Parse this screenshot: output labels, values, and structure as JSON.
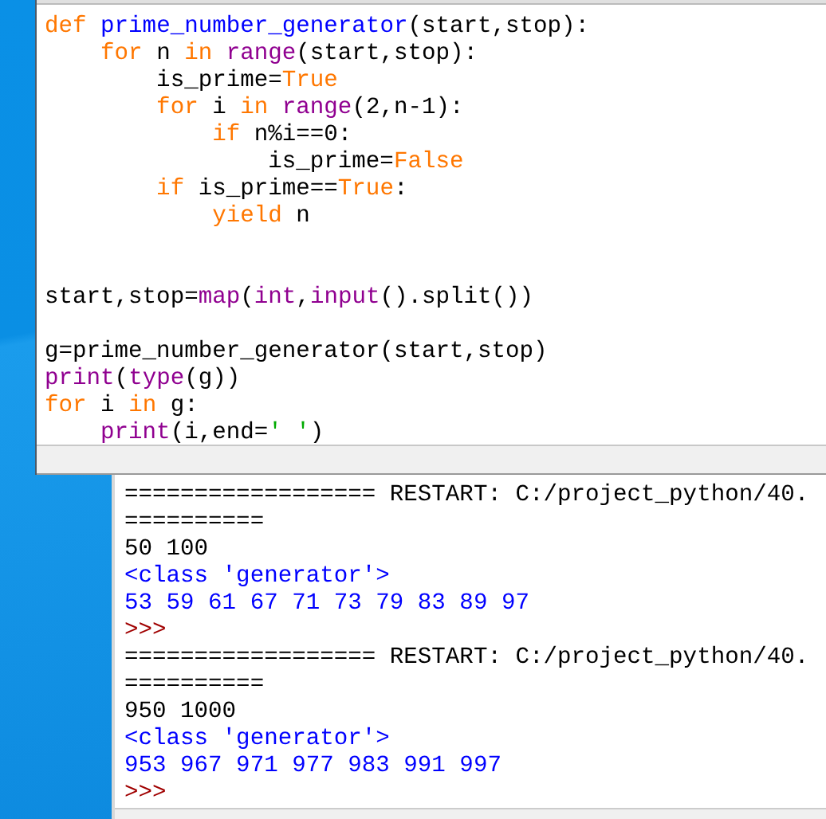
{
  "editor": {
    "lines": [
      {
        "kind": "code",
        "tokens": [
          {
            "text": "def",
            "kind": "keyword"
          },
          {
            "text": " prime_number_generator",
            "kind": "definition"
          },
          {
            "text": "(start,stop):",
            "kind": "plain"
          }
        ]
      },
      {
        "kind": "code",
        "tokens": [
          {
            "text": "    for",
            "kind": "keyword"
          },
          {
            "text": " n ",
            "kind": "plain"
          },
          {
            "text": "in",
            "kind": "keyword"
          },
          {
            "text": " range",
            "kind": "builtin"
          },
          {
            "text": "(start,stop):",
            "kind": "plain"
          }
        ]
      },
      {
        "kind": "code",
        "tokens": [
          {
            "text": "        is_prime=",
            "kind": "plain"
          },
          {
            "text": "True",
            "kind": "keyword"
          }
        ]
      },
      {
        "kind": "code",
        "tokens": [
          {
            "text": "        for",
            "kind": "keyword"
          },
          {
            "text": " i ",
            "kind": "plain"
          },
          {
            "text": "in",
            "kind": "keyword"
          },
          {
            "text": " range",
            "kind": "builtin"
          },
          {
            "text": "(2,n-1):",
            "kind": "plain"
          }
        ]
      },
      {
        "kind": "code",
        "tokens": [
          {
            "text": "            if",
            "kind": "keyword"
          },
          {
            "text": " n%i==0:",
            "kind": "plain"
          }
        ]
      },
      {
        "kind": "code",
        "tokens": [
          {
            "text": "                is_prime=",
            "kind": "plain"
          },
          {
            "text": "False",
            "kind": "keyword"
          }
        ]
      },
      {
        "kind": "code",
        "tokens": [
          {
            "text": "        if",
            "kind": "keyword"
          },
          {
            "text": " is_prime==",
            "kind": "plain"
          },
          {
            "text": "True",
            "kind": "keyword"
          },
          {
            "text": ":",
            "kind": "plain"
          }
        ]
      },
      {
        "kind": "code",
        "tokens": [
          {
            "text": "            yield",
            "kind": "keyword"
          },
          {
            "text": " n",
            "kind": "plain"
          }
        ]
      },
      {
        "kind": "blank"
      },
      {
        "kind": "blank"
      },
      {
        "kind": "code",
        "tokens": [
          {
            "text": "start,stop=",
            "kind": "plain"
          },
          {
            "text": "map",
            "kind": "builtin"
          },
          {
            "text": "(",
            "kind": "plain"
          },
          {
            "text": "int",
            "kind": "builtin"
          },
          {
            "text": ",",
            "kind": "plain"
          },
          {
            "text": "input",
            "kind": "builtin"
          },
          {
            "text": "().split())",
            "kind": "plain"
          }
        ]
      },
      {
        "kind": "blank"
      },
      {
        "kind": "code",
        "tokens": [
          {
            "text": "g=prime_number_generator(start,stop)",
            "kind": "plain"
          }
        ]
      },
      {
        "kind": "code",
        "tokens": [
          {
            "text": "print",
            "kind": "builtin"
          },
          {
            "text": "(",
            "kind": "plain"
          },
          {
            "text": "type",
            "kind": "builtin"
          },
          {
            "text": "(g))",
            "kind": "plain"
          }
        ]
      },
      {
        "kind": "code",
        "tokens": [
          {
            "text": "for",
            "kind": "keyword"
          },
          {
            "text": " i ",
            "kind": "plain"
          },
          {
            "text": "in",
            "kind": "keyword"
          },
          {
            "text": " g:",
            "kind": "plain"
          }
        ]
      },
      {
        "kind": "code",
        "tokens": [
          {
            "text": "    print",
            "kind": "builtin"
          },
          {
            "text": "(i,end=",
            "kind": "plain"
          },
          {
            "text": "' '",
            "kind": "string"
          },
          {
            "text": ")",
            "kind": "plain"
          }
        ]
      }
    ]
  },
  "shell": {
    "lines": [
      {
        "text": "================== RESTART: C:/project_python/40.",
        "kind": "plain"
      },
      {
        "text": "==========",
        "kind": "plain"
      },
      {
        "text": "50 100",
        "kind": "plain"
      },
      {
        "text": "<class 'generator'>",
        "kind": "output"
      },
      {
        "text": "53 59 61 67 71 73 79 83 89 97",
        "kind": "output"
      },
      {
        "text": ">>>",
        "kind": "prompt"
      },
      {
        "text": "================== RESTART: C:/project_python/40.",
        "kind": "plain"
      },
      {
        "text": "==========",
        "kind": "plain"
      },
      {
        "text": "950 1000",
        "kind": "plain"
      },
      {
        "text": "<class 'generator'>",
        "kind": "output"
      },
      {
        "text": "953 967 971 977 983 991 997",
        "kind": "output"
      },
      {
        "text": ">>>",
        "kind": "prompt"
      }
    ]
  }
}
